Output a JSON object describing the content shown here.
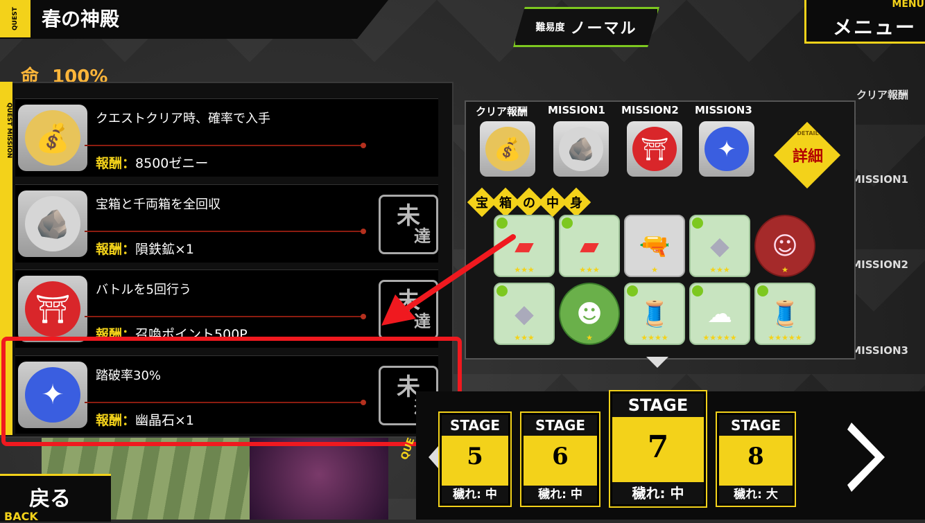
{
  "header": {
    "quest_tag": "QUEST",
    "title": "春の神殿"
  },
  "difficulty": {
    "label": "難易度",
    "value": "ノーマル"
  },
  "menu": {
    "en": "MENU",
    "jp": "メニュー"
  },
  "life": {
    "label": "命",
    "value": "100%"
  },
  "mission_panel": {
    "side_tab": "QUEST MISSION",
    "rows": [
      {
        "header": "クリア報酬",
        "text": "クエストクリア時、確率で入手",
        "reward_label": "報酬：",
        "reward": "8500ゼニー",
        "icon": "gold-coins-icon",
        "status": ""
      },
      {
        "header": "MISSION1",
        "text": "宝箱と千両箱を全回収",
        "reward_label": "報酬：",
        "reward": "隕鉄鉱×1",
        "icon": "meteorite-ore-icon",
        "status_top": "未",
        "status_bottom": "達"
      },
      {
        "header": "MISSION2",
        "text": "バトルを5回行う",
        "reward_label": "報酬：",
        "reward": "召喚ポイント500P",
        "icon": "summon-point-icon",
        "status_top": "未",
        "status_bottom": "達"
      },
      {
        "header": "MISSION3",
        "text": "踏破率30%",
        "reward_label": "報酬：",
        "reward": "幽晶石×1",
        "icon": "crystal-stone-icon",
        "status_top": "未",
        "status_bottom": "達"
      }
    ]
  },
  "reward_panel": {
    "headers": [
      "クリア報酬",
      "MISSION1",
      "MISSION2",
      "MISSION3"
    ],
    "detail": {
      "en": "DETAIL",
      "jp": "詳細"
    },
    "chest_title": [
      "宝",
      "箱",
      "の",
      "中",
      "身"
    ],
    "chest_items": [
      {
        "icon": "red-cloth-icon",
        "stars": "★★★"
      },
      {
        "icon": "red-cloth-icon",
        "stars": "★★★"
      },
      {
        "icon": "revolver-icon",
        "stars": "★"
      },
      {
        "icon": "silver-crystal-icon",
        "stars": "★★★"
      },
      {
        "icon": "character-girl-icon",
        "stars": "★"
      },
      {
        "icon": "silver-crystal-icon",
        "stars": "★★★"
      },
      {
        "icon": "green-creature-icon",
        "stars": "★"
      },
      {
        "icon": "blue-thread-icon",
        "stars": "★★★★"
      },
      {
        "icon": "white-fabric-icon",
        "stars": "★★★★★"
      },
      {
        "icon": "gold-thread-icon",
        "stars": "★★★★★"
      }
    ]
  },
  "stages": [
    {
      "label": "STAGE",
      "number": "5",
      "kegare": "穢れ: 中"
    },
    {
      "label": "STAGE",
      "number": "6",
      "kegare": "穢れ: 中"
    },
    {
      "label": "STAGE",
      "number": "7",
      "kegare": "穢れ: 中"
    },
    {
      "label": "STAGE",
      "number": "8",
      "kegare": "穢れ: 大"
    }
  ],
  "stage_side_text": "QUE",
  "back": {
    "jp": "戻る",
    "en": "BACK"
  },
  "colors": {
    "accent": "#f3d21a",
    "highlight": "#f0191f",
    "difficulty": "#7dc820"
  }
}
